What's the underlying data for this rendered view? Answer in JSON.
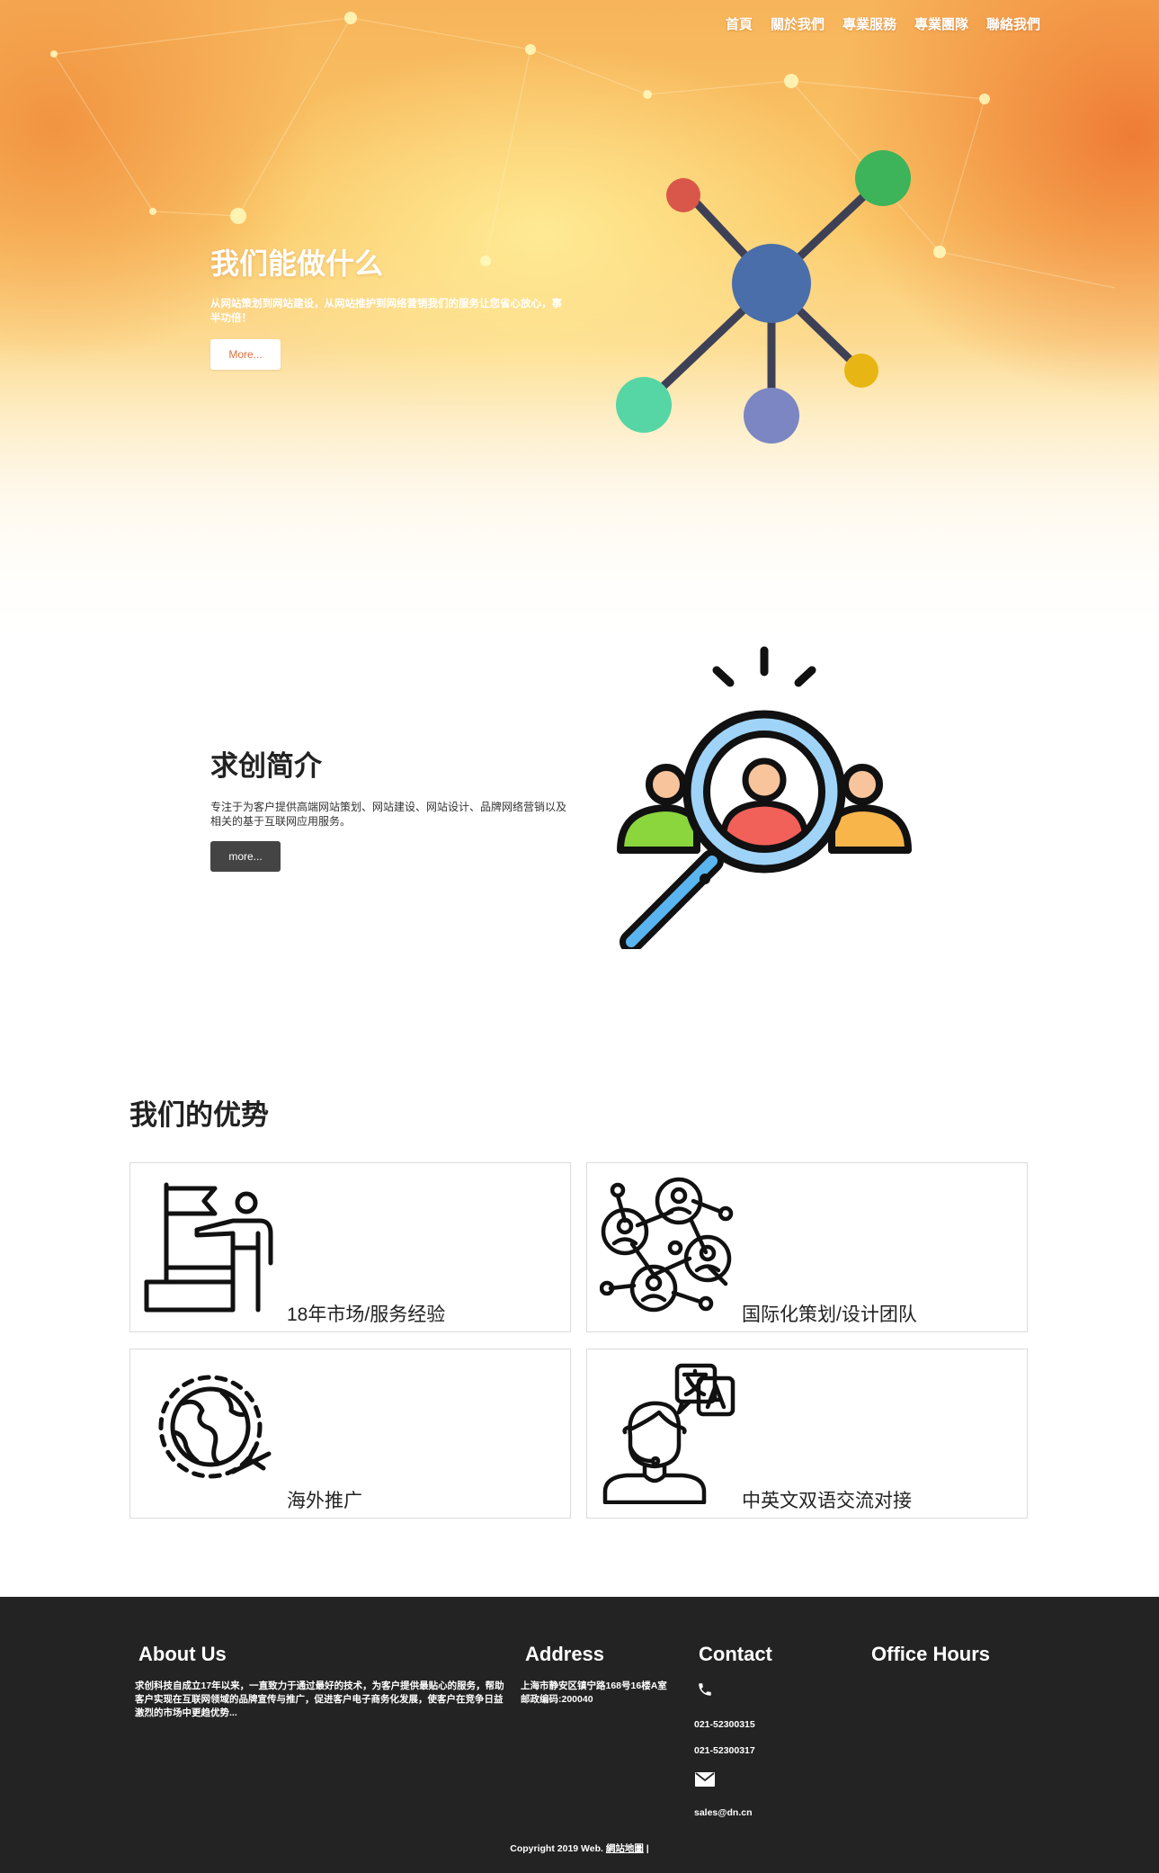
{
  "nav": {
    "items": [
      {
        "label": "首頁"
      },
      {
        "label": "關於我們"
      },
      {
        "label": "專業服務"
      },
      {
        "label": "專業團隊"
      },
      {
        "label": "聯絡我們"
      }
    ]
  },
  "hero": {
    "title": "我们能做什么",
    "text": "从网站策划到网站建设，从网站推护到网络营销我们的服务让您省心放心，事半功倍！",
    "button": "More..."
  },
  "about": {
    "title": "求创简介",
    "text": "专注于为客户提供高端网站策划、网站建设、网站设计、品牌网络营销以及相关的基于互联网应用服务。",
    "button": "more..."
  },
  "advantages": {
    "title": "我们的优势",
    "items": [
      {
        "label": "18年市场/服务经验",
        "icon": "flag-summit-icon"
      },
      {
        "label": "国际化策划/设计团队",
        "icon": "team-network-icon"
      },
      {
        "label": "海外推广",
        "icon": "globe-plane-icon"
      },
      {
        "label": "中英文双语交流对接",
        "icon": "bilingual-support-icon"
      }
    ]
  },
  "footer": {
    "about": {
      "title": "About Us",
      "text": "求创科技自成立17年以来，一直致力于通过最好的技术，为客户提供最贴心的服务，帮助客户实现在互联网领域的品牌宣传与推广，促进客户电子商务化发展，使客户在竞争日益激烈的市场中更趋优势..."
    },
    "address": {
      "title": "Address",
      "line1": "上海市静安区镇宁路168号16楼A室",
      "line2": "邮政编码:200040"
    },
    "contact": {
      "title": "Contact",
      "phone1": "021-52300315",
      "phone2": "021-52300317",
      "email": "sales@dn.cn"
    },
    "hours": {
      "title": "Office Hours"
    },
    "copyright": "Copyright 2019 Web.",
    "sitemap": "網站地圖",
    "separator": "|"
  },
  "colors": {
    "hero_orange": "#f0a04a",
    "button_text_orange": "#e0703a",
    "about_button": "#444444",
    "footer_bg": "#232323",
    "node_center": "#4a6ea9",
    "node_green": "#3db35a",
    "node_red": "#d9574a",
    "node_teal": "#55d6a4",
    "node_purple": "#7b86c2",
    "node_yellow": "#e8b614",
    "magnifier_blue": "#5ab4f0",
    "person_green": "#8ad63c",
    "person_orange": "#f7b54a",
    "person_red": "#f2605a",
    "skin": "#f7c49c"
  }
}
